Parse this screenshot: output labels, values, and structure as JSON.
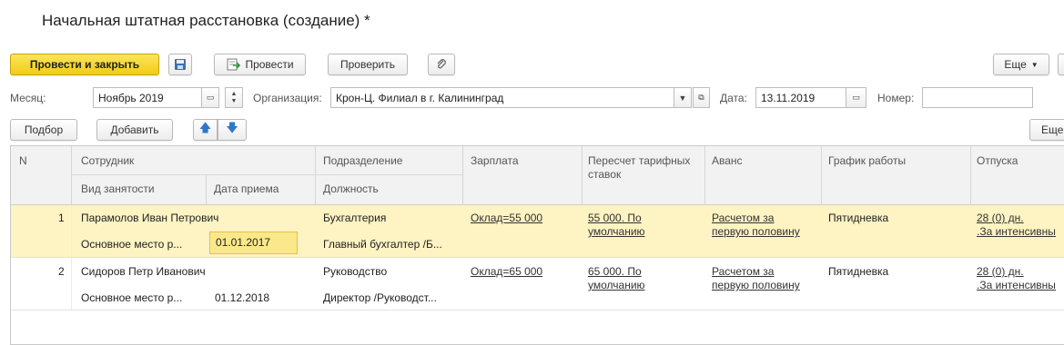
{
  "title": "Начальная штатная расстановка (создание) *",
  "toolbar": {
    "post_close": "Провести и закрыть",
    "post": "Провести",
    "check": "Проверить",
    "more": "Еще"
  },
  "header_fields": {
    "month_label": "Месяц:",
    "month_value": "Ноябрь 2019",
    "org_label": "Организация:",
    "org_value": "Крон-Ц. Филиал в г. Калининград",
    "date_label": "Дата:",
    "date_value": "13.11.2019",
    "number_label": "Номер:",
    "number_value": ""
  },
  "table_toolbar": {
    "select": "Подбор",
    "add": "Добавить",
    "more": "Еще"
  },
  "columns": {
    "n": "N",
    "employee": "Сотрудник",
    "employment_type": "Вид занятости",
    "hire_date": "Дата приема",
    "department": "Подразделение",
    "position": "Должность",
    "salary": "Зарплата",
    "recalc_line1": "Пересчет тарифных",
    "recalc_line2": "ставок",
    "advance": "Аванс",
    "schedule": "График работы",
    "vacations": "Отпуска"
  },
  "rows": [
    {
      "n": "1",
      "employee": "Парамолов Иван Петрович",
      "employment_type": "Основное место р...",
      "hire_date": "01.01.2017",
      "department": "Бухгалтерия",
      "position": "Главный бухгалтер /Б...",
      "salary": "Оклад=55 000",
      "recalc_line1": "55 000. По",
      "recalc_line2": "умолчанию",
      "advance_line1": "Расчетом за",
      "advance_line2": "первую половину",
      "schedule": "Пятидневка",
      "vacation_line1": "28 (0) дн.",
      "vacation_line2": ".За интенсивны"
    },
    {
      "n": "2",
      "employee": "Сидоров Петр Иванович",
      "employment_type": "Основное место р...",
      "hire_date": "01.12.2018",
      "department": "Руководство",
      "position": "Директор /Руководст...",
      "salary": "Оклад=65 000",
      "recalc_line1": "65 000. По",
      "recalc_line2": "умолчанию",
      "advance_line1": "Расчетом за",
      "advance_line2": "первую половину",
      "schedule": "Пятидневка",
      "vacation_line1": "28 (0) дн.",
      "vacation_line2": ".За интенсивны"
    }
  ],
  "colors": {
    "accent_button": "#f2cb15",
    "selected_row": "#fdf3c3",
    "selected_cell": "#fbe88a"
  }
}
